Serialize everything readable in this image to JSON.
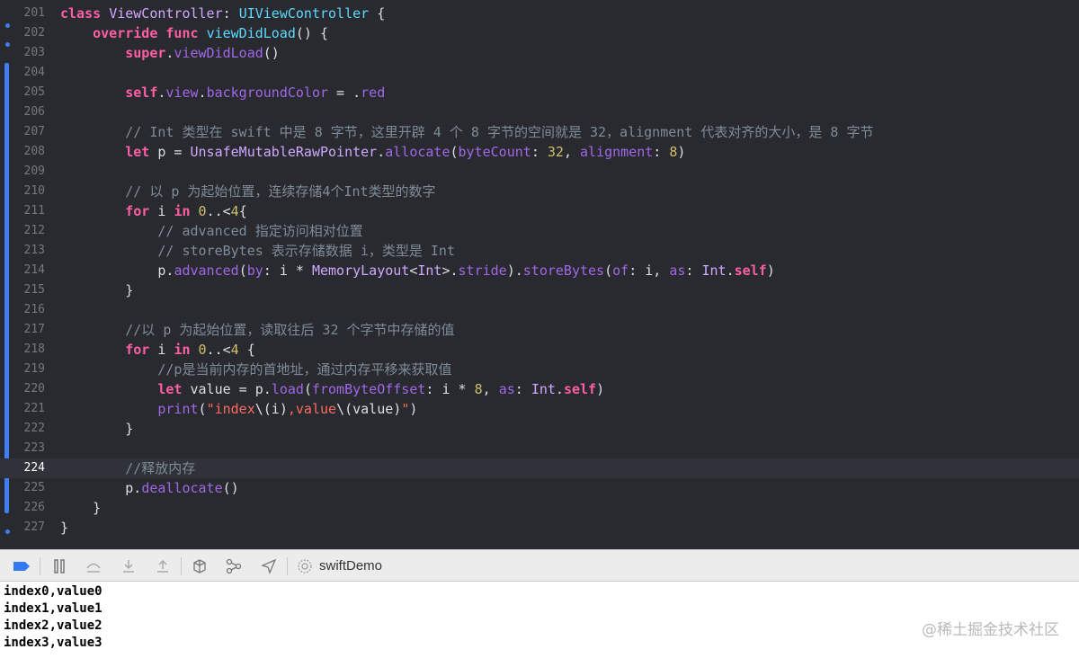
{
  "editor": {
    "lines": [
      {
        "n": "201",
        "html": "<span class=\"kw\">class</span> <span class=\"ty\">ViewController</span>: <span class=\"cls\">UIViewController</span> {"
      },
      {
        "n": "202",
        "html": "    <span class=\"kw\">override func</span> <span class=\"cls\">viewDidLoad</span>() {"
      },
      {
        "n": "203",
        "html": "        <span class=\"kw\">super</span>.<span class=\"fn\">viewDidLoad</span>()"
      },
      {
        "n": "204",
        "html": ""
      },
      {
        "n": "205",
        "html": "        <span class=\"kw\">self</span>.<span class=\"fn\">view</span>.<span class=\"fn\">backgroundColor</span> = .<span class=\"fn\">red</span>"
      },
      {
        "n": "206",
        "html": ""
      },
      {
        "n": "207",
        "html": "        <span class=\"cm\">// Int 类型在 swift 中是 8 字节，这里开辟 4 个 8 字节的空间就是 32，alignment 代表对齐的大小，是 8 字节</span>"
      },
      {
        "n": "208",
        "html": "        <span class=\"kw\">let</span> p = <span class=\"ty\">UnsafeMutableRawPointer</span>.<span class=\"fn\">allocate</span>(<span class=\"fn\">byteCount</span>: <span class=\"num\">32</span>, <span class=\"fn\">alignment</span>: <span class=\"num\">8</span>)"
      },
      {
        "n": "209",
        "html": ""
      },
      {
        "n": "210",
        "html": "        <span class=\"cm\">// 以 p 为起始位置，连续存储4个Int类型的数字</span>"
      },
      {
        "n": "211",
        "html": "        <span class=\"kw\">for</span> i <span class=\"kw\">in</span> <span class=\"num\">0</span>..&lt;<span class=\"num\">4</span>{"
      },
      {
        "n": "212",
        "html": "            <span class=\"cm\">// advanced 指定访问相对位置</span>"
      },
      {
        "n": "213",
        "html": "            <span class=\"cm\">// storeBytes 表示存储数据 i，类型是 Int</span>"
      },
      {
        "n": "214",
        "html": "            p.<span class=\"fn\">advanced</span>(<span class=\"fn\">by</span>: i * <span class=\"ty\">MemoryLayout</span>&lt;<span class=\"ty\">Int</span>&gt;.<span class=\"fn\">stride</span>).<span class=\"fn\">storeBytes</span>(<span class=\"fn\">of</span>: i, <span class=\"fn\">as</span>: <span class=\"ty\">Int</span>.<span class=\"kw\">self</span>)"
      },
      {
        "n": "215",
        "html": "        }"
      },
      {
        "n": "216",
        "html": ""
      },
      {
        "n": "217",
        "html": "        <span class=\"cm\">//以 p 为起始位置，读取往后 32 个字节中存储的值</span>"
      },
      {
        "n": "218",
        "html": "        <span class=\"kw\">for</span> i <span class=\"kw\">in</span> <span class=\"num\">0</span>..&lt;<span class=\"num\">4</span> {"
      },
      {
        "n": "219",
        "html": "            <span class=\"cm\">//p是当前内存的首地址，通过内存平移来获取值</span>"
      },
      {
        "n": "220",
        "html": "            <span class=\"kw\">let</span> value = p.<span class=\"fn\">load</span>(<span class=\"fn\">fromByteOffset</span>: i * <span class=\"num\">8</span>, <span class=\"fn\">as</span>: <span class=\"ty\">Int</span>.<span class=\"kw\">self</span>)"
      },
      {
        "n": "221",
        "html": "            <span class=\"fn\">print</span>(<span class=\"str\">\"index</span>\\(i)<span class=\"str\">,value</span>\\(value)<span class=\"str\">\"</span>)"
      },
      {
        "n": "222",
        "html": "        }"
      },
      {
        "n": "223",
        "html": ""
      },
      {
        "n": "224",
        "html": "        <span class=\"cm\">//释放内存</span>",
        "current": true
      },
      {
        "n": "225",
        "html": "        p.<span class=\"fn\">deallocate</span>()"
      },
      {
        "n": "226",
        "html": "    }"
      },
      {
        "n": "227",
        "html": "}"
      }
    ]
  },
  "debug_bar": {
    "scheme_name": "swiftDemo",
    "icons": [
      "breakpoints-toggle-icon",
      "pause-icon",
      "step-over-icon",
      "step-into-icon",
      "step-out-icon",
      "debug-view-hierarchy-icon",
      "memory-graph-icon",
      "simulate-location-icon",
      "scheme-icon"
    ]
  },
  "console": {
    "output": [
      "index0,value0",
      "index1,value1",
      "index2,value2",
      "index3,value3"
    ]
  },
  "watermark": "@稀土掘金技术社区",
  "colors": {
    "editor_bg": "#292a30",
    "keyword": "#fc5fa3",
    "comment": "#7f8c98",
    "number": "#d0bf69",
    "accent": "#3f7ef5"
  }
}
